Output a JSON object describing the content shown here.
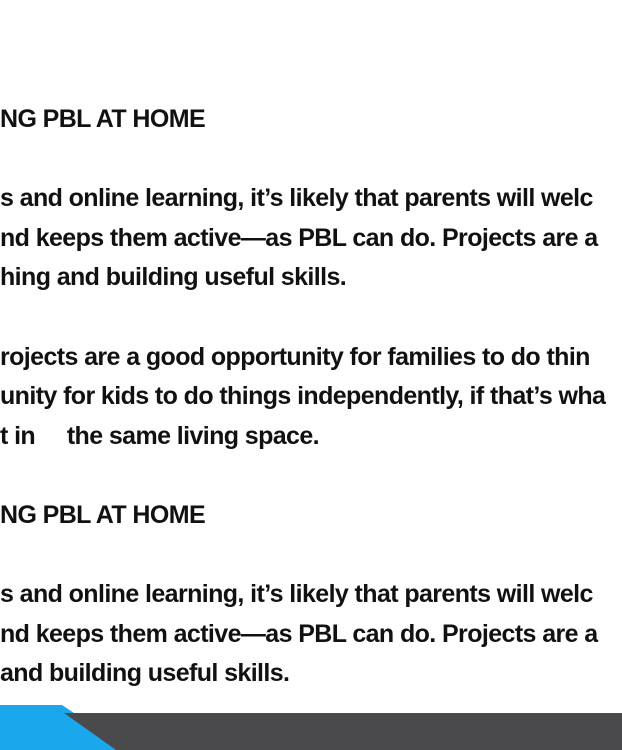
{
  "section1": {
    "heading": "NG PBL AT HOME",
    "para1": [
      "s and online learning, it’s likely that parents will welc",
      "nd keeps them active—as PBL can do. Projects are a",
      "hing and building useful skills."
    ],
    "para2": [
      "rojects are a good opportunity for families to do thin",
      "unity for kids to do things independently, if that’s wha",
      "t in     the same living space."
    ]
  },
  "section2": {
    "heading": "NG PBL AT HOME",
    "para1": [
      "s and online learning, it’s likely that parents will welc",
      "nd keeps them active—as PBL can do. Projects are a",
      "and building useful skills."
    ]
  },
  "colors": {
    "text": "#111111",
    "footer_bar": "#4a4a4d",
    "accent": "#1aa7ec"
  }
}
